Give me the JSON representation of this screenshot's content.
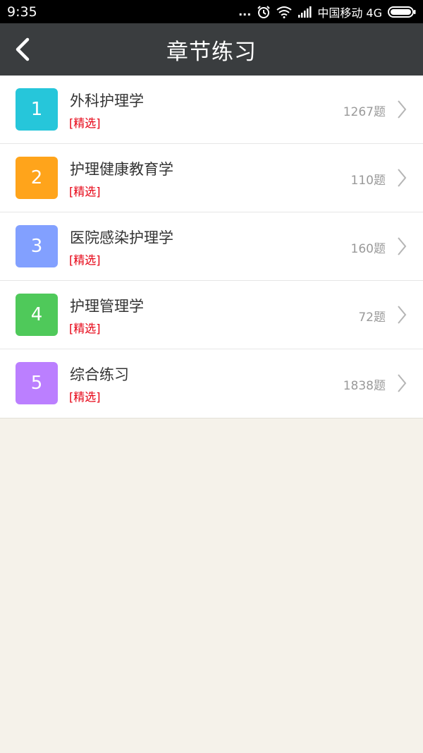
{
  "status_bar": {
    "time": "9:35",
    "dots": "...",
    "carrier": "中国移动 4G",
    "icons": [
      "alarm-icon",
      "wifi-icon",
      "signal-icon",
      "battery-icon"
    ]
  },
  "navbar": {
    "title": "章节练习",
    "back_icon": "back-icon"
  },
  "colors": {
    "status_bar": "#000000",
    "navbar": "#3a3d3f",
    "background": "#f5f2ea",
    "tag": "#e60012",
    "count": "#9a9a9a"
  },
  "chapters": [
    {
      "number": "1",
      "title": "外科护理学",
      "tag": "[精选]",
      "count": "1267题",
      "color": "#26c6da"
    },
    {
      "number": "2",
      "title": "护理健康教育学",
      "tag": "[精选]",
      "count": "110题",
      "color": "#ffa41b"
    },
    {
      "number": "3",
      "title": "医院感染护理学",
      "tag": "[精选]",
      "count": "160题",
      "color": "#82a0ff"
    },
    {
      "number": "4",
      "title": "护理管理学",
      "tag": "[精选]",
      "count": "72题",
      "color": "#4fc95a"
    },
    {
      "number": "5",
      "title": "综合练习",
      "tag": "[精选]",
      "count": "1838题",
      "color": "#bb7fff"
    }
  ]
}
